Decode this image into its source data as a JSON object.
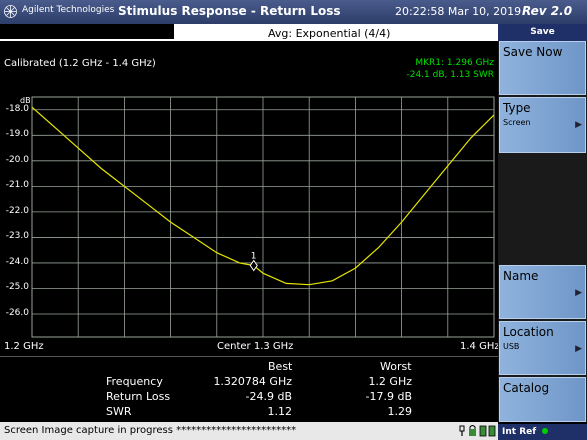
{
  "header": {
    "brand": "Agilent Technologies",
    "title": "Stimulus Response - Return Loss",
    "datetime": "20:22:58  Mar 10, 2019",
    "revision": "Rev 2.0"
  },
  "info": {
    "averaging": "Avg: Exponential (4/4)"
  },
  "plot": {
    "calibration": "Calibrated (1.2 GHz - 1.4 GHz)",
    "marker_line1": "MKR1: 1.296 GHz",
    "marker_line2": "-24.1 dB, 1.13 SWR",
    "marker_number": "1",
    "y_unit": "dB",
    "x_left": "1.2 GHz",
    "x_center": "Center 1.3 GHz",
    "x_right": "1.4 GHz",
    "trace_color": "#e6e600",
    "grid_color": "#9aa49a"
  },
  "chart_data": {
    "type": "line",
    "ylabel": "dB",
    "ylim": [
      -26.9,
      -17.5
    ],
    "xlim": [
      1.2,
      1.4
    ],
    "yticks": [
      "-18.0",
      "-19.0",
      "-20.0",
      "-21.0",
      "-22.0",
      "-23.0",
      "-24.0",
      "-25.0",
      "-26.0"
    ],
    "ytick_values": [
      -18,
      -19,
      -20,
      -21,
      -22,
      -23,
      -24,
      -25,
      -26
    ],
    "series": [
      {
        "x": [
          1.2,
          1.21,
          1.22,
          1.23,
          1.24,
          1.25,
          1.26,
          1.27,
          1.28,
          1.29,
          1.296,
          1.3,
          1.31,
          1.32,
          1.33,
          1.34,
          1.35,
          1.36,
          1.37,
          1.38,
          1.39,
          1.4
        ],
        "values": [
          -17.9,
          -18.7,
          -19.5,
          -20.3,
          -21.0,
          -21.7,
          -22.4,
          -23.0,
          -23.6,
          -24.0,
          -24.1,
          -24.4,
          -24.8,
          -24.85,
          -24.7,
          -24.2,
          -23.4,
          -22.4,
          -21.3,
          -20.2,
          -19.1,
          -18.2
        ]
      }
    ],
    "marker": {
      "x": 1.296,
      "y": -24.1,
      "label": "1"
    },
    "grid": true
  },
  "results": {
    "col_best": "Best",
    "col_worst": "Worst",
    "rows": [
      {
        "label": "Frequency",
        "best": "1.320784 GHz",
        "worst": "1.2 GHz"
      },
      {
        "label": "Return Loss",
        "best": "-24.9 dB",
        "worst": "-17.9 dB"
      },
      {
        "label": "SWR",
        "best": "1.12",
        "worst": "1.29"
      }
    ]
  },
  "status": {
    "text": "Screen Image capture in progress  ************************"
  },
  "softkeys": {
    "header": "Save",
    "save_now": "Save Now",
    "type": "Type",
    "type_value": "Screen",
    "name": "Name",
    "location": "Location",
    "location_value": "USB",
    "catalog": "Catalog",
    "int_ref": "Int Ref"
  }
}
